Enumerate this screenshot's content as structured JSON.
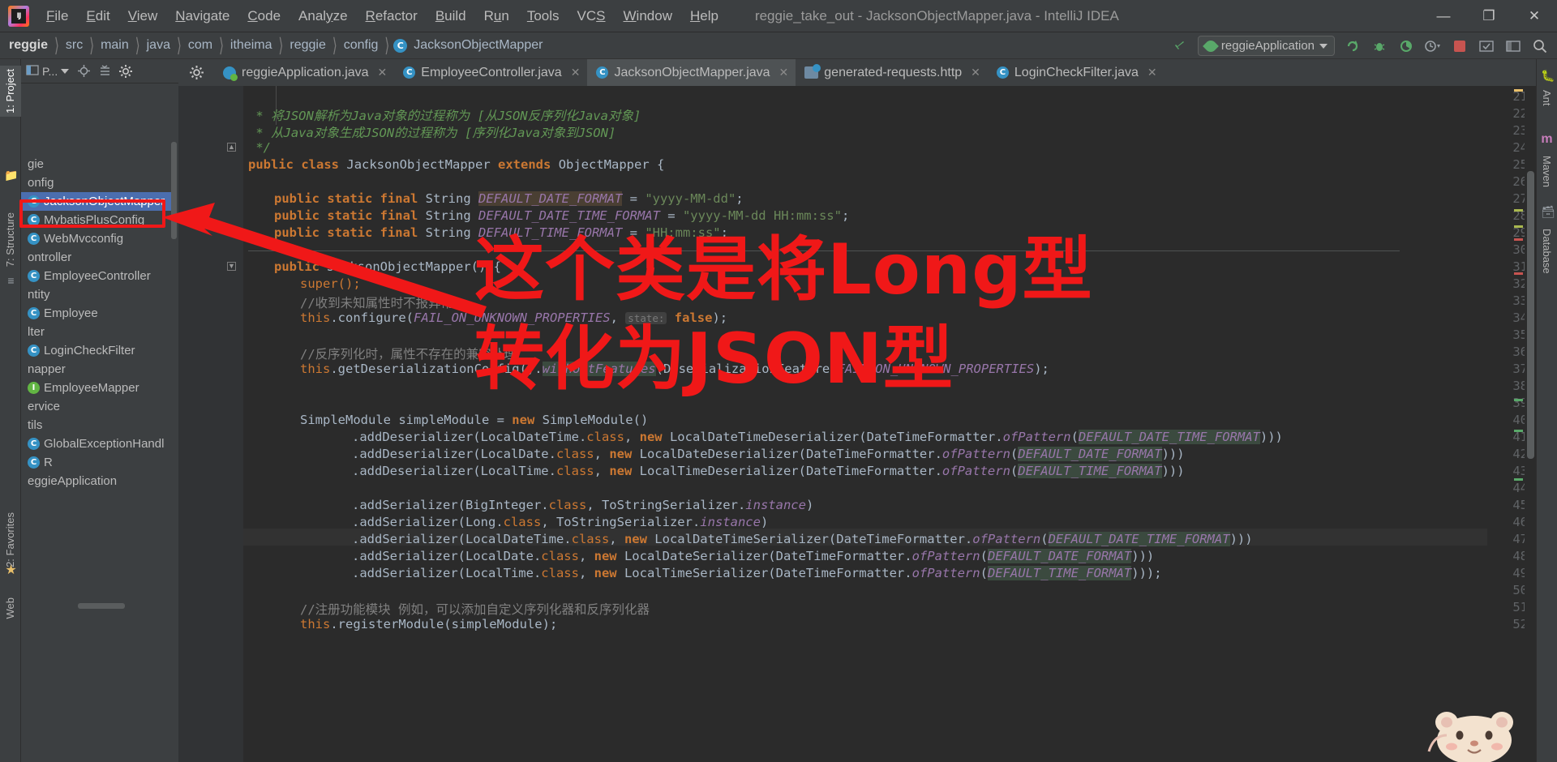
{
  "window": {
    "title": "reggie_take_out - JacksonObjectMapper.java - IntelliJ IDEA",
    "minimize": "—",
    "maximize": "❐",
    "close": "✕"
  },
  "menubar": {
    "items": [
      {
        "pre": "",
        "mn": "F",
        "post": "ile"
      },
      {
        "pre": "",
        "mn": "E",
        "post": "dit"
      },
      {
        "pre": "",
        "mn": "V",
        "post": "iew"
      },
      {
        "pre": "",
        "mn": "N",
        "post": "avigate"
      },
      {
        "pre": "",
        "mn": "C",
        "post": "ode"
      },
      {
        "pre": "Anal",
        "mn": "y",
        "post": "ze"
      },
      {
        "pre": "",
        "mn": "R",
        "post": "efactor"
      },
      {
        "pre": "",
        "mn": "B",
        "post": "uild"
      },
      {
        "pre": "R",
        "mn": "u",
        "post": "n"
      },
      {
        "pre": "",
        "mn": "T",
        "post": "ools"
      },
      {
        "pre": "VC",
        "mn": "S",
        "post": ""
      },
      {
        "pre": "",
        "mn": "W",
        "post": "indow"
      },
      {
        "pre": "",
        "mn": "H",
        "post": "elp"
      }
    ]
  },
  "breadcrumb": {
    "items": [
      "reggie",
      "src",
      "main",
      "java",
      "com",
      "itheima",
      "reggie",
      "config"
    ],
    "current": "JacksonObjectMapper",
    "current_badge": "C"
  },
  "toolbar": {
    "run_config": "reggieApplication",
    "icons": [
      "build-hammer-icon",
      "rerun-icon",
      "debug-icon",
      "coverage-icon",
      "profiler-icon",
      "stop-icon",
      "update-icon",
      "layout-icon",
      "search-everywhere-icon"
    ]
  },
  "left_strips": {
    "top_tabs": [
      "1: Project"
    ],
    "mid_tabs": [
      "7: Structure"
    ],
    "bottom_tabs": [
      "2: Favorites"
    ],
    "bottom_icon": "favorites-star-icon",
    "web_tab": "Web"
  },
  "right_strips": {
    "tabs": [
      "Ant",
      "m Maven",
      "Database"
    ],
    "items": [
      {
        "label": "Ant"
      },
      {
        "label": "Maven",
        "icon": "maven-m-icon"
      },
      {
        "label": "Database",
        "icon": "database-icon"
      }
    ]
  },
  "project_panel": {
    "title": "P...",
    "icons": [
      "project-view-icon",
      "dropdown-icon",
      "locate-icon",
      "collapse-all-icon",
      "settings-gear-icon"
    ],
    "tree": [
      {
        "label": "gie",
        "icon": "folder",
        "indent": 0
      },
      {
        "label": "onfig",
        "icon": "folder",
        "indent": 0
      },
      {
        "label": "JacksonObjectMapper",
        "icon": "class",
        "indent": 1,
        "selected": true
      },
      {
        "label": "MybatisPlusConfig",
        "icon": "class",
        "indent": 1
      },
      {
        "label": "WebMvcconfig",
        "icon": "class",
        "indent": 1
      },
      {
        "label": "ontroller",
        "icon": "folder",
        "indent": 0
      },
      {
        "label": "EmployeeController",
        "icon": "class",
        "indent": 1
      },
      {
        "label": "ntity",
        "icon": "folder",
        "indent": 0
      },
      {
        "label": "Employee",
        "icon": "class",
        "indent": 1
      },
      {
        "label": "lter",
        "icon": "folder",
        "indent": 0
      },
      {
        "label": "LoginCheckFilter",
        "icon": "class",
        "indent": 1
      },
      {
        "label": "napper",
        "icon": "folder",
        "indent": 0
      },
      {
        "label": "EmployeeMapper",
        "icon": "interface",
        "indent": 1
      },
      {
        "label": "ervice",
        "icon": "folder",
        "indent": 0
      },
      {
        "label": "tils",
        "icon": "folder",
        "indent": 0
      },
      {
        "label": "GlobalExceptionHandl",
        "icon": "class",
        "indent": 1
      },
      {
        "label": "R",
        "icon": "class",
        "indent": 1
      },
      {
        "label": "eggieApplication",
        "icon": "folder",
        "indent": 0
      }
    ]
  },
  "editor_tabs": [
    {
      "label": "reggieApplication.java",
      "icon": "spring-boot-icon",
      "active": false,
      "close": "✕"
    },
    {
      "label": "EmployeeController.java",
      "icon": "java-class-icon",
      "active": false,
      "close": "✕"
    },
    {
      "label": "JacksonObjectMapper.java",
      "icon": "java-class-icon",
      "active": true,
      "close": "✕"
    },
    {
      "label": "generated-requests.http",
      "icon": "http-file-icon",
      "active": false,
      "close": "✕"
    },
    {
      "label": "LoginCheckFilter.java",
      "icon": "java-class-icon",
      "active": false,
      "close": "✕"
    }
  ],
  "code": {
    "first_line_number": 21,
    "lines": [
      {
        "n": 21,
        "partial": true
      },
      {
        "n": 22
      },
      {
        "n": 23
      },
      {
        "n": 24
      },
      {
        "n": 25
      },
      {
        "n": 26
      },
      {
        "n": 27
      },
      {
        "n": 28
      },
      {
        "n": 29
      },
      {
        "n": 30
      },
      {
        "n": 31
      },
      {
        "n": 32
      },
      {
        "n": 33
      },
      {
        "n": 34
      },
      {
        "n": 35
      },
      {
        "n": 36
      },
      {
        "n": 37
      },
      {
        "n": 38
      },
      {
        "n": 39
      },
      {
        "n": 40
      },
      {
        "n": 41
      },
      {
        "n": 42
      },
      {
        "n": 43
      },
      {
        "n": 44
      },
      {
        "n": 45
      },
      {
        "n": 46
      },
      {
        "n": 47
      },
      {
        "n": 48
      },
      {
        "n": 49
      },
      {
        "n": 50
      },
      {
        "n": 51
      },
      {
        "n": 52
      }
    ],
    "text": {
      "l22": " * 将JSON解析为Java对象的过程称为 [从JSON反序列化Java对象]",
      "l23": " * 从Java对象生成JSON的过程称为 [序列化Java对象到JSON]",
      "l24": " */",
      "l25_kw1": "public",
      "l25_kw2": "class",
      "l25_name": "JacksonObjectMapper",
      "l25_kw3": "extends",
      "l25_super": "ObjectMapper {",
      "l27_mods": "public static final",
      "l27_type": "String",
      "l27_const": "DEFAULT_DATE_FORMAT",
      "l27_val": "\"yyyy-MM-dd\"",
      "l28_const": "DEFAULT_DATE_TIME_FORMAT",
      "l28_val": "\"yyyy-MM-dd HH:mm:ss\"",
      "l29_const": "DEFAULT_TIME_FORMAT",
      "l29_val": "\"HH:mm:ss\"",
      "l31": "public JacksonObjectMapper() {",
      "l32": "super();",
      "l33": "//收到未知属性时不报异常",
      "l34_call": "this.configure(",
      "l34_const": "FAIL_ON_UNKNOWN_PROPERTIES",
      "l34_hint": "state:",
      "l34_bool": "false",
      "l36": "//反序列化时，属性不存在的兼容处理",
      "l37": "this.getDeserializationConfig().withoutFeatures(DeserializationFeature.FAIL_ON_UNKNOWN_PROPERTIES)",
      "l40": "SimpleModule simpleModule = new SimpleModule()",
      "l41": ".addDeserializer(LocalDateTime.class, new LocalDateTimeDeserializer(DateTimeFormatter.ofPattern(DEFAULT_DATE_TIME_FORMAT)))",
      "l42": ".addDeserializer(LocalDate.class, new LocalDateDeserializer(DateTimeFormatter.ofPattern(DEFAULT_DATE_FORMAT)))",
      "l43": ".addDeserializer(LocalTime.class, new LocalTimeDeserializer(DateTimeFormatter.ofPattern(DEFAULT_TIME_FORMAT)))",
      "l45": ".addSerializer(BigInteger.class, ToStringSerializer.instance)",
      "l46": ".addSerializer(Long.class, ToStringSerializer.instance)",
      "l47": ".addSerializer(LocalDateTime.class, new LocalDateTimeSerializer(DateTimeFormatter.ofPattern(DEFAULT_DATE_TIME_FORMAT)))",
      "l48": ".addSerializer(LocalDate.class, new LocalDateSerializer(DateTimeFormatter.ofPattern(DEFAULT_DATE_FORMAT)))",
      "l49": ".addSerializer(LocalTime.class, new LocalTimeSerializer(DateTimeFormatter.ofPattern(DEFAULT_TIME_FORMAT)));",
      "l51": "//注册功能模块 例如，可以添加自定义序列化器和反序列化器",
      "l52": "this.registerModule(simpleModule);"
    }
  },
  "annotations": {
    "line1": "这个类是将Long型",
    "line2": "转化为JSON型",
    "color": "#f01818",
    "highlight_target": "JacksonObjectMapper"
  },
  "colors": {
    "accent_blue": "#3592c4",
    "selection_blue": "#4b6eaf",
    "editor_bg": "#2b2b2b",
    "panel_bg": "#3c3f41",
    "annotation_red": "#f01818",
    "green_run": "#59a869",
    "string_green": "#6a8759",
    "keyword_orange": "#cc7832",
    "const_purple": "#9876aa"
  }
}
